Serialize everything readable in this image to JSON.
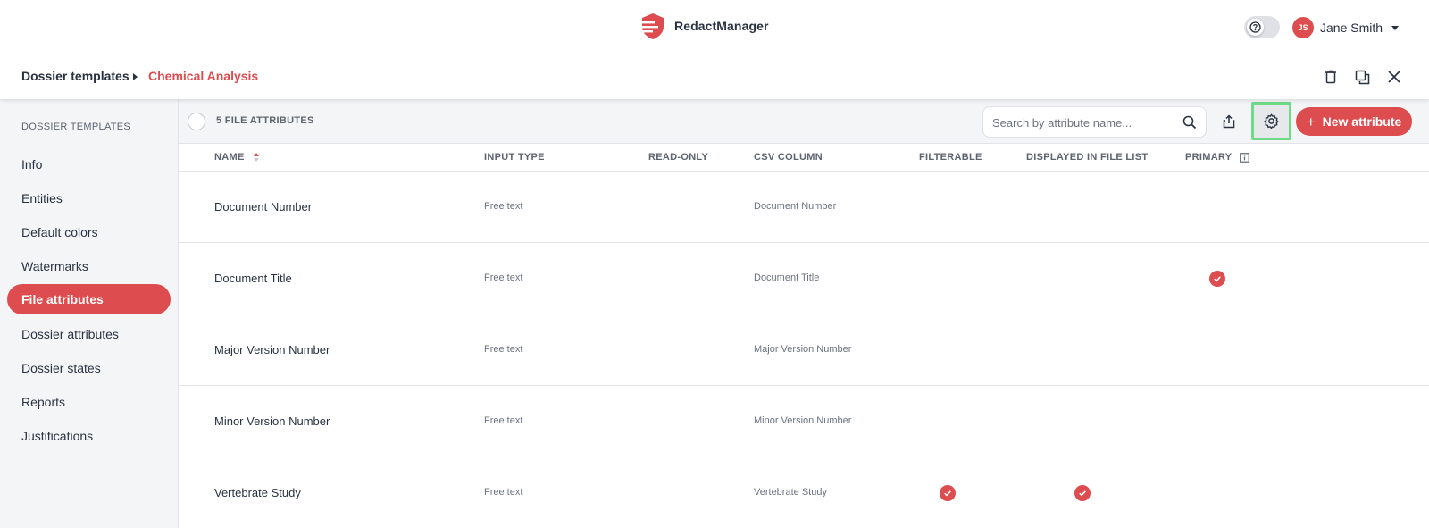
{
  "app": {
    "name": "RedactManager",
    "brand_color": "#dd4d50"
  },
  "header": {
    "help_toggle_icon": "help-icon",
    "user": {
      "initials": "JS",
      "name": "Jane Smith"
    }
  },
  "breadcrumb": {
    "root": "Dossier templates",
    "current": "Chemical Analysis",
    "actions": [
      "delete-icon",
      "duplicate-icon",
      "close-icon"
    ]
  },
  "sidebar": {
    "title": "DOSSIER TEMPLATES",
    "items": [
      {
        "label": "Info",
        "active": false
      },
      {
        "label": "Entities",
        "active": false
      },
      {
        "label": "Default colors",
        "active": false
      },
      {
        "label": "Watermarks",
        "active": false
      },
      {
        "label": "File attributes",
        "active": true
      },
      {
        "label": "Dossier attributes",
        "active": false
      },
      {
        "label": "Dossier states",
        "active": false
      },
      {
        "label": "Reports",
        "active": false
      },
      {
        "label": "Justifications",
        "active": false
      }
    ]
  },
  "toolbar": {
    "count_label": "5 FILE ATTRIBUTES",
    "search_placeholder": "Search by attribute name...",
    "new_button_label": "New attribute"
  },
  "table": {
    "columns": {
      "name": "NAME",
      "input_type": "INPUT TYPE",
      "read_only": "READ-ONLY",
      "csv_column": "CSV COLUMN",
      "filterable": "FILTERABLE",
      "displayed": "DISPLAYED IN FILE LIST",
      "primary": "PRIMARY"
    },
    "rows": [
      {
        "name": "Document Number",
        "input_type": "Free text",
        "csv_column": "Document Number",
        "read_only": false,
        "filterable": false,
        "displayed": false,
        "primary": false
      },
      {
        "name": "Document Title",
        "input_type": "Free text",
        "csv_column": "Document Title",
        "read_only": false,
        "filterable": false,
        "displayed": false,
        "primary": true
      },
      {
        "name": "Major Version Number",
        "input_type": "Free text",
        "csv_column": "Major Version Number",
        "read_only": false,
        "filterable": false,
        "displayed": false,
        "primary": false
      },
      {
        "name": "Minor Version Number",
        "input_type": "Free text",
        "csv_column": "Minor Version Number",
        "read_only": false,
        "filterable": false,
        "displayed": false,
        "primary": false
      },
      {
        "name": "Vertebrate Study",
        "input_type": "Free text",
        "csv_column": "Vertebrate Study",
        "read_only": false,
        "filterable": true,
        "displayed": true,
        "primary": false
      }
    ]
  }
}
